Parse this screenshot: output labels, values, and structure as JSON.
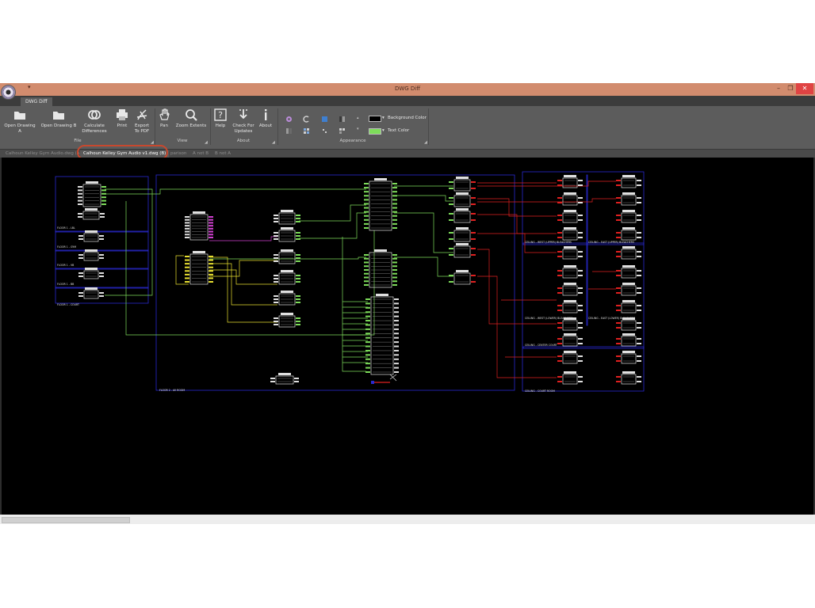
{
  "window": {
    "title": "DWG Diff",
    "qat_symbol": "▾",
    "minimize": "–",
    "maximize": "❐",
    "close": "✕"
  },
  "ribbon_tabs": [
    "DWG Diff"
  ],
  "ribbon": {
    "file_group": {
      "label": "File",
      "buttons": {
        "open_a": "Open Drawing A",
        "open_b": "Open Drawing B",
        "calculate_line1": "Calculate",
        "calculate_line2": "Differences",
        "print": "Print",
        "export_line1": "Export",
        "export_line2": "To PDF"
      }
    },
    "view_group": {
      "label": "View",
      "buttons": {
        "pan": "Pan",
        "zoom_extents": "Zoom Extents"
      }
    },
    "about_group": {
      "label": "About",
      "buttons": {
        "help": "Help",
        "updates_line1": "Check For",
        "updates_line2": "Updates",
        "about": "About"
      }
    },
    "appearance_group": {
      "label": "Appearance",
      "background_color": "Background Color",
      "text_color": "Text Color",
      "background_swatch": "#000000",
      "text_swatch": "#7ddc5a"
    }
  },
  "document_tabs": [
    {
      "label": "Calhoun Kelley Gym Audio.dwg (A)",
      "active": false
    },
    {
      "label": "Calhoun Kelley Gym Audio v1.dwg (B)",
      "active": true
    },
    {
      "label": "parison",
      "active": false
    },
    {
      "label": "A not B",
      "active": false
    },
    {
      "label": "B not A",
      "active": false
    }
  ],
  "colors": {
    "accent_titlebar": "#d28c6e",
    "close_button": "#e04343",
    "callout_ring": "#c8482e",
    "wire_green": "#7ddc5a",
    "wire_red": "#e02020",
    "wire_yellow": "#e8e030",
    "wire_magenta": "#d040d0",
    "frame_blue": "#2a2ad0"
  },
  "drawing": {
    "labels": {
      "floor_1_lbl": "FLOOR 1 - LBL",
      "floor_1_gym": "FLOOR 1 - GYM",
      "floor_1_vb": "FLOOR 1 - VB",
      "floor_1_bb": "FLOOR 1 - BB",
      "floor_1_court": "FLOOR 1 - COURT",
      "floor_2": "FLOOR 2 - AV ROOM",
      "ceiling_west_upper": "CEILING - WEST (UPPER) BLEACHERS",
      "ceiling_east_upper": "CEILING - EAST (UPPER) BLEACHERS",
      "ceiling_west_lower": "CEILING - WEST (LOWER) BLEACHERS",
      "ceiling_east_lower": "CEILING - EAST (LOWER) BLEACHERS",
      "ceiling_center": "CEILING - CENTER COURT",
      "ceiling_court": "CEILING - COURT ROOM"
    }
  }
}
